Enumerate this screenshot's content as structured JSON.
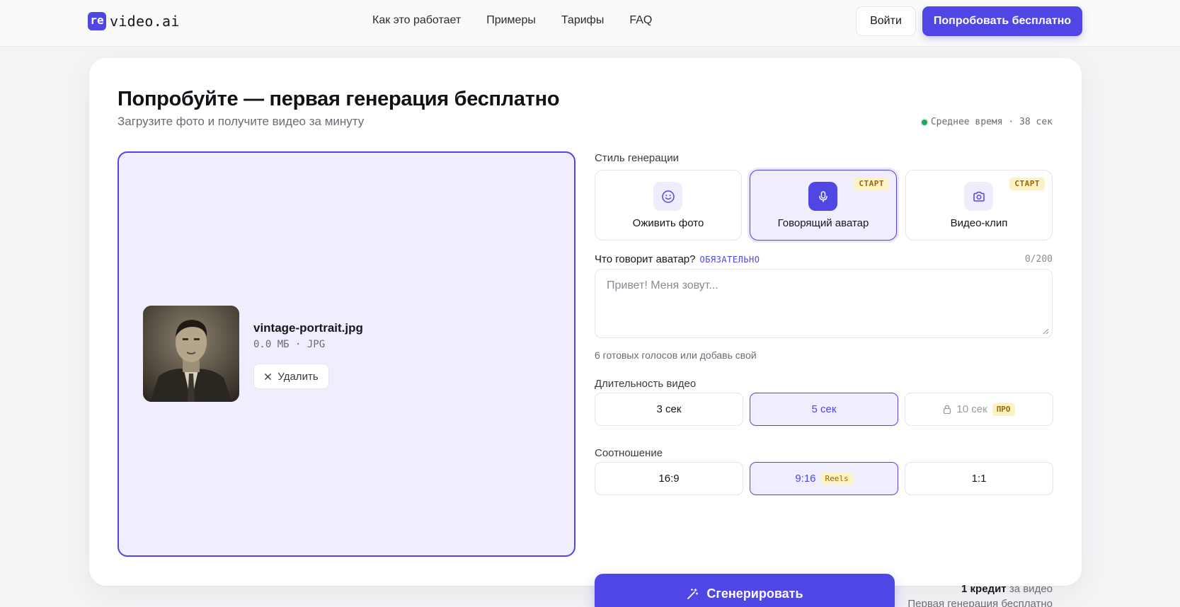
{
  "header": {
    "logo_badge": "re",
    "logo_text": "video.ai",
    "nav": [
      "Как это работает",
      "Примеры",
      "Тарифы",
      "FAQ"
    ],
    "login": "Войти",
    "try_free": "Попробовать бесплатно"
  },
  "main": {
    "title": "Попробуйте — первая генерация бесплатно",
    "subtitle": "Загрузите фото и получите видео за минуту",
    "avg_time": "Среднее время · 38 сек"
  },
  "upload": {
    "file_name": "vintage-portrait.jpg",
    "file_meta": "0.0 МБ · JPG",
    "delete": "Удалить"
  },
  "style": {
    "label": "Стиль генерации",
    "options": [
      {
        "label": "Оживить фото",
        "icon": "smile-icon",
        "tag": "",
        "active": false
      },
      {
        "label": "Говорящий аватар",
        "icon": "mic-icon",
        "tag": "СТАРТ",
        "active": true
      },
      {
        "label": "Видео-клип",
        "icon": "camera-icon",
        "tag": "СТАРТ",
        "active": false
      }
    ]
  },
  "speech": {
    "label": "Что говорит аватар?",
    "required": "ОБЯЗАТЕЛЬНО",
    "counter": "0/200",
    "placeholder": "Привет! Меня зовут...",
    "hint": "6 готовых голосов или добавь свой"
  },
  "duration": {
    "label": "Длительность видео",
    "options": [
      {
        "label": "3 сек"
      },
      {
        "label": "5 сек",
        "active": true
      },
      {
        "label": "10 сек",
        "chip": "ПРО",
        "locked": true
      }
    ]
  },
  "ratio": {
    "label": "Соотношение",
    "options": [
      {
        "label": "16:9"
      },
      {
        "label": "9:16",
        "chip": "Reels",
        "active": true
      },
      {
        "label": "1:1"
      }
    ]
  },
  "generate": {
    "label": "Сгенерировать",
    "credit_bold": "1 кредит",
    "credit_rest": "за видео",
    "free_note": "Первая генерация бесплатно"
  },
  "colors": {
    "accent": "#4f46e5",
    "accent_light": "#f0eefe",
    "tag_bg": "#fdf1c7",
    "status_green": "#22a55b"
  }
}
